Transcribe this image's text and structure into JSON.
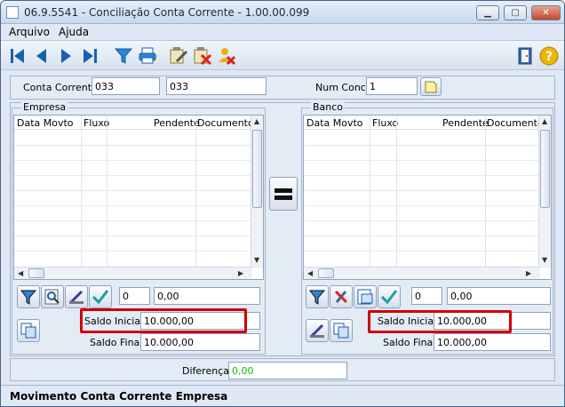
{
  "window": {
    "title": "06.9.5541 - Conciliação Conta Corrente - 1.00.00.099"
  },
  "menu": {
    "items": [
      "Arquivo",
      "Ajuda"
    ]
  },
  "toolbar": {
    "icons": [
      "first-record-icon",
      "previous-record-icon",
      "next-record-icon",
      "last-record-icon",
      "filter-icon",
      "print-icon",
      "edit-records-icon",
      "delete-records-icon",
      "user-delete-icon",
      "exit-door-icon",
      "help-icon"
    ]
  },
  "header": {
    "conta_corrente_label": "Conta Corrente:",
    "conta_corrente_code": "033",
    "conta_corrente_name": "033",
    "num_concil_label": "Num Concil:",
    "num_concil_value": "1"
  },
  "empresa": {
    "title": "Empresa",
    "columns": [
      "Data Movto",
      "Fluxo",
      "Pendente",
      "Documento"
    ],
    "count": "0",
    "total": "0,00",
    "saldo_inicial_label": "Saldo Inicial:",
    "saldo_inicial": "10.000,00",
    "saldo_final_label": "Saldo Final:",
    "saldo_final": "10.000,00"
  },
  "banco": {
    "title": "Banco",
    "columns": [
      "Data Movto",
      "Fluxo",
      "Pendente",
      "Documento"
    ],
    "count": "0",
    "total": "0,00",
    "saldo_inicial_label": "Saldo Inicial:",
    "saldo_inicial": "10.000,00",
    "saldo_final_label": "Saldo Final:",
    "saldo_final": "10.000,00"
  },
  "diferenca": {
    "label": "Diferença:",
    "value": "0,00",
    "value_color": "#00c000"
  },
  "status": {
    "text": "Movimento Conta Corrente Empresa"
  },
  "colors": {
    "highlight": "#d10000",
    "window_bg": "#dfe8f4"
  }
}
